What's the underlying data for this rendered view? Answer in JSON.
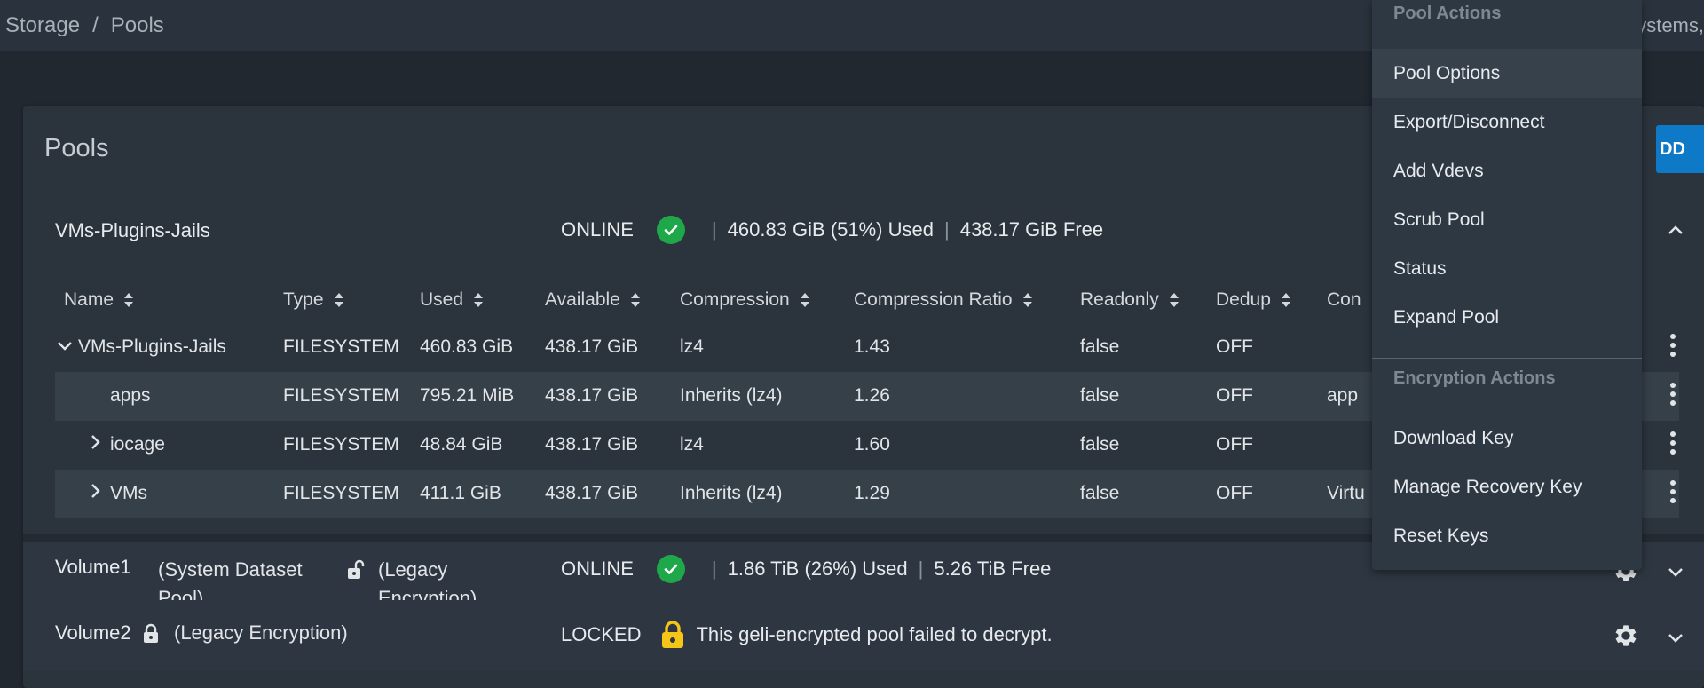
{
  "breadcrumb": {
    "parent": "Storage",
    "separator": "/",
    "current": "Pools"
  },
  "topbar_right_text": "ystems,",
  "card": {
    "title": "Pools",
    "add_button": "DD"
  },
  "pools": [
    {
      "name": "VMs-Plugins-Jails",
      "status": "ONLINE",
      "used": "460.83 GiB (51%) Used",
      "free": "438.17 GiB Free"
    },
    {
      "name": "Volume1",
      "tag": "(System Dataset Pool)",
      "encryption": "(Legacy Encryption)",
      "status": "ONLINE",
      "used": "1.86 TiB (26%) Used",
      "free": "5.26 TiB Free"
    },
    {
      "name": "Volume2",
      "encryption": "(Legacy Encryption)",
      "status": "LOCKED",
      "message": "This geli-encrypted pool failed to decrypt."
    }
  ],
  "table": {
    "columns": [
      "Name",
      "Type",
      "Used",
      "Available",
      "Compression",
      "Compression Ratio",
      "Readonly",
      "Dedup",
      "Con"
    ],
    "rows": [
      {
        "name": "VMs-Plugins-Jails",
        "type": "FILESYSTEM",
        "used": "460.83 GiB",
        "available": "438.17 GiB",
        "compression": "lz4",
        "ratio": "1.43",
        "readonly": "false",
        "dedup": "OFF",
        "comment": ""
      },
      {
        "name": "apps",
        "type": "FILESYSTEM",
        "used": "795.21 MiB",
        "available": "438.17 GiB",
        "compression": "Inherits (lz4)",
        "ratio": "1.26",
        "readonly": "false",
        "dedup": "OFF",
        "comment": "app"
      },
      {
        "name": "iocage",
        "type": "FILESYSTEM",
        "used": "48.84 GiB",
        "available": "438.17 GiB",
        "compression": "lz4",
        "ratio": "1.60",
        "readonly": "false",
        "dedup": "OFF",
        "comment": ""
      },
      {
        "name": "VMs",
        "type": "FILESYSTEM",
        "used": "411.1 GiB",
        "available": "438.17 GiB",
        "compression": "Inherits (lz4)",
        "ratio": "1.29",
        "readonly": "false",
        "dedup": "OFF",
        "comment": "Virtu"
      }
    ]
  },
  "menu": {
    "pool_actions_header": "Pool Actions",
    "pool_actions": [
      "Pool Options",
      "Export/Disconnect",
      "Add Vdevs",
      "Scrub Pool",
      "Status",
      "Expand Pool"
    ],
    "encryption_actions_header": "Encryption Actions",
    "encryption_actions": [
      "Download Key",
      "Manage Recovery Key",
      "Reset Keys"
    ]
  },
  "colors": {
    "accent": "#0e79c7",
    "online": "#1fa84a",
    "locked": "#f5c518",
    "background": "#212830",
    "card": "#2b343d"
  }
}
